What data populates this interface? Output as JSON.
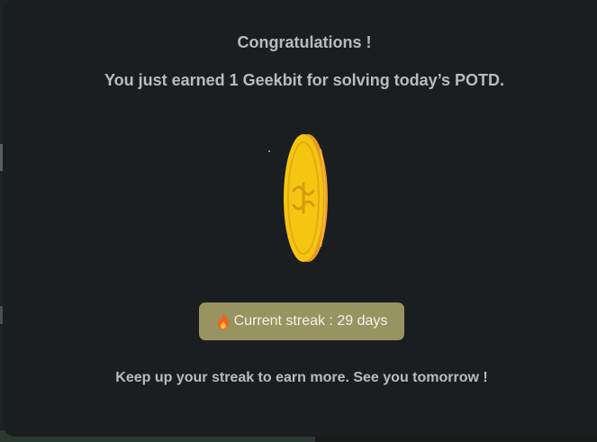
{
  "modal": {
    "title": "Congratulations !",
    "subtitle": "You just earned 1 Geekbit for solving today’s POTD.",
    "coin_icon": "geekbit-coin-icon",
    "streak": {
      "icon": "fire-icon",
      "text": "Current streak : 29 days"
    },
    "footer": "Keep up your streak to earn more. See you tomorrow !"
  },
  "colors": {
    "modal_bg": "#1b1e20",
    "text": "#b8bcbf",
    "badge_bg": "#989462",
    "coin_face": "#f2c414",
    "coin_edge": "#e9a01e"
  }
}
